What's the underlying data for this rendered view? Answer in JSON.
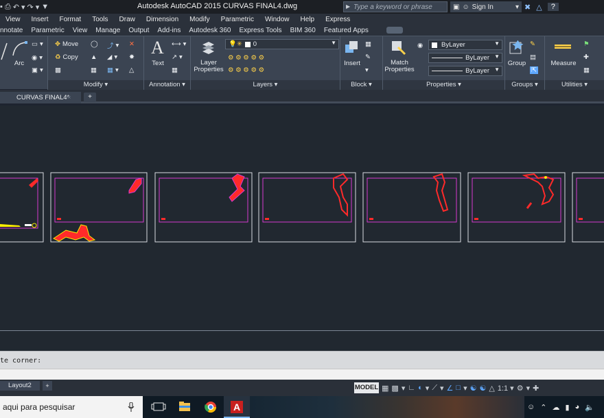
{
  "titlebar": {
    "app_title": "Autodesk AutoCAD 2015    CURVAS FINAL4.dwg",
    "search_placeholder": "Type a keyword or phrase",
    "sign_in": "Sign In"
  },
  "menu": [
    "View",
    "Insert",
    "Format",
    "Tools",
    "Draw",
    "Dimension",
    "Modify",
    "Parametric",
    "Window",
    "Help",
    "Express"
  ],
  "ribbon_tabs": [
    "nnotate",
    "Parametric",
    "View",
    "Manage",
    "Output",
    "Add-ins",
    "Autodesk 360",
    "Express Tools",
    "BIM 360",
    "Featured Apps"
  ],
  "ribbon": {
    "draw": {
      "arc": "Arc"
    },
    "modify": {
      "move": "Move",
      "copy": "Copy",
      "title": "Modify ▾"
    },
    "annotation": {
      "text": "Text",
      "title": "Annotation ▾"
    },
    "layers": {
      "layer_properties": "Layer Properties",
      "current_layer": "0",
      "title": "Layers ▾"
    },
    "block": {
      "insert": "Insert",
      "title": "Block ▾"
    },
    "properties": {
      "match": "Match Properties",
      "color": "ByLayer",
      "linetype": "ByLayer",
      "lineweight": "ByLayer",
      "title": "Properties ▾"
    },
    "groups": {
      "group": "Group",
      "title": "Groups ▾"
    },
    "utilities": {
      "measure": "Measure",
      "title": "Utilities ▾"
    }
  },
  "doc_tabs": {
    "file": "CURVAS FINAL4*",
    "close": "×",
    "plus": "+"
  },
  "command_line": {
    "prompt": "te corner:"
  },
  "layout_tabs": {
    "layout2": "Layout2",
    "plus": "+"
  },
  "status": {
    "model": "MODEL",
    "scale": "1:1 ▾"
  },
  "taskbar": {
    "search_text": "aqui para pesquisar"
  },
  "colors": {
    "magenta": "#d63ad0",
    "white_frame": "#d9dde2",
    "red": "#ff2a2a",
    "yellow": "#ffee00"
  }
}
